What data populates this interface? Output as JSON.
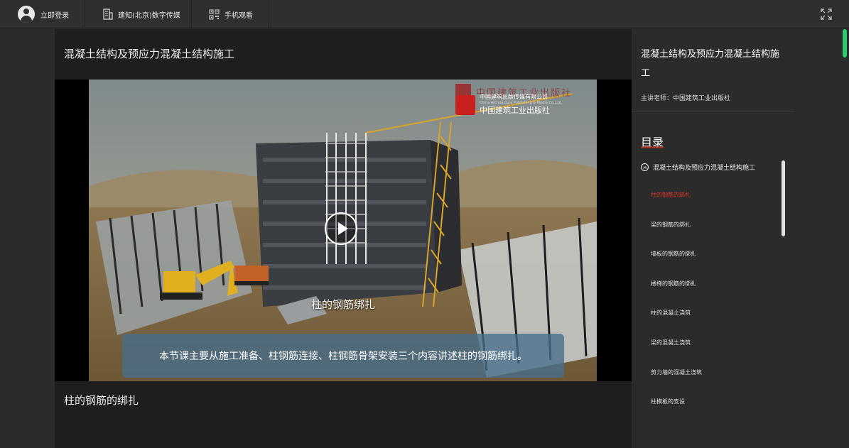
{
  "topbar": {
    "login_label": "立即登录",
    "brand_label": "建知(北京)数字传媒",
    "mobile_label": "手机观看"
  },
  "main": {
    "lesson_title": "混凝土结构及预应力混凝土结构施工",
    "chapter_name": "柱的钢筋的绑扎"
  },
  "video": {
    "watermark_top": "中国建筑工业出版社",
    "publisher_cn": "中国建筑出版传媒有限公司",
    "publisher_en": "China Architecture Publishing & Media Co.,Ltd.",
    "publisher_big": "中国建筑工业出版社",
    "caption_title": "柱的钢筋绑扎",
    "subtitle": "本节课主要从施工准备、柱钢筋连接、柱钢筋骨架安装三个内容讲述柱的钢筋绑扎。"
  },
  "sidebar": {
    "course_title": "混凝土结构及预应力混凝土结构施工",
    "teacher": "主讲老师：中国建筑工业出版社",
    "toc_heading": "目录",
    "chapter": "混凝土结构及预应力混凝土结构施工",
    "items": [
      {
        "label": "柱的钢筋的绑扎"
      },
      {
        "label": "梁的钢筋的绑扎"
      },
      {
        "label": "墙板的钢筋的绑扎"
      },
      {
        "label": "楼梯的钢筋的绑扎"
      },
      {
        "label": "柱的混凝土浇筑"
      },
      {
        "label": "梁的混凝土浇筑"
      },
      {
        "label": "剪力墙的混凝土浇筑"
      },
      {
        "label": "柱模板的支设"
      }
    ],
    "active_index": 0
  },
  "colors": {
    "accent_active": "#d9362c",
    "page_scroll": "#2ecc71",
    "background": "#2b2b2b",
    "panel": "#1e1e1e"
  },
  "icons": [
    "avatar-icon",
    "building-icon",
    "qr-code-icon",
    "fullscreen-icon",
    "play-icon",
    "chevron-up-circle-icon"
  ]
}
